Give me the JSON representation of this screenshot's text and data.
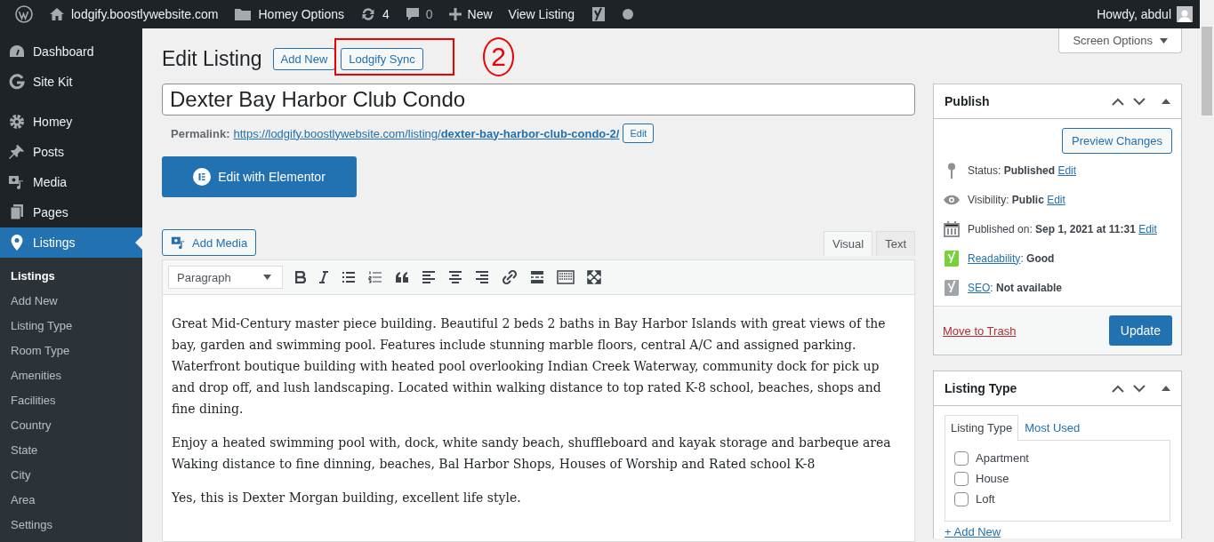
{
  "admin_bar": {
    "site": "lodgify.boostlywebsite.com",
    "items": [
      {
        "kind": "folder",
        "label": "Homey Options"
      },
      {
        "kind": "updates",
        "label": "4"
      },
      {
        "kind": "comments",
        "label": "0"
      },
      {
        "kind": "new",
        "label": "New"
      },
      {
        "kind": "link",
        "label": "View Listing"
      },
      {
        "kind": "yoast"
      },
      {
        "kind": "dot"
      }
    ],
    "account": "Howdy, abdul"
  },
  "sidebar": {
    "items": [
      {
        "label": "Dashboard",
        "selected": false
      },
      {
        "label": "Site Kit",
        "selected": false
      },
      {
        "label": "Homey",
        "selected": false
      },
      {
        "label": "Posts",
        "selected": false
      },
      {
        "label": "Media",
        "selected": false
      },
      {
        "label": "Pages",
        "selected": false
      },
      {
        "label": "Listings",
        "selected": true
      }
    ],
    "submenu": [
      {
        "label": "Listings",
        "selected": true
      },
      {
        "label": "Add New",
        "selected": false
      },
      {
        "label": "Listing Type",
        "selected": false
      },
      {
        "label": "Room Type",
        "selected": false
      },
      {
        "label": "Amenities",
        "selected": false
      },
      {
        "label": "Facilities",
        "selected": false
      },
      {
        "label": "Country",
        "selected": false
      },
      {
        "label": "State",
        "selected": false
      },
      {
        "label": "City",
        "selected": false
      },
      {
        "label": "Area",
        "selected": false
      },
      {
        "label": "Settings",
        "selected": false
      }
    ]
  },
  "screen_options": "Screen Options",
  "header": {
    "title": "Edit Listing",
    "buttons": [
      "Add New",
      "Lodgify Sync"
    ]
  },
  "annotation": {
    "label": "2"
  },
  "title_field": {
    "value": "Dexter Bay Harbor Club Condo"
  },
  "permalink": {
    "label": "Permalink:",
    "base": "https://lodgify.boostlywebsite.com/listing/",
    "slug": "dexter-bay-harbor-club-condo-2/",
    "button": "Edit"
  },
  "elementor_button": "Edit with Elementor",
  "add_media": "Add Media",
  "editor_tabs": [
    {
      "label": "Visual",
      "selected": true
    },
    {
      "label": "Text",
      "selected": false
    }
  ],
  "format_select": "Paragraph",
  "paragraphs": [
    "Great Mid-Century master piece building.  Beautiful 2 beds 2 baths in Bay Harbor Islands with great views of the bay, garden and swimming pool. Features include stunning marble floors, central A/C and assigned parking. Waterfront boutique building with heated pool overlooking Indian Creek Waterway, community dock for pick up and drop off, and lush landscaping. Located within walking distance to top rated K-8 school, beaches, shops and fine dining.",
    "Enjoy a heated swimming pool with, dock, white sandy beach, shuffleboard and kayak storage and barbeque area Waking distance to fine dinning, beaches, Bal Harbor Shops, Houses of Worship and Rated school K-8",
    "Yes, this is Dexter Morgan building, excellent life style."
  ],
  "publish": {
    "title": "Publish",
    "preview": "Preview Changes",
    "rows": [
      {
        "kind": "status",
        "text": "Status: **Published**",
        "link": "Edit"
      },
      {
        "kind": "visibility",
        "text": "Visibility: **Public**",
        "link": "Edit"
      },
      {
        "kind": "date",
        "text": "Published on: **Sep 1, 2021 at 11:31**",
        "link": "Edit"
      },
      {
        "kind": "yoast",
        "color": "#7ad03a",
        "link": "Readability",
        "text": ": **Good**"
      },
      {
        "kind": "yoast",
        "color": "#a0a5aa",
        "link": "SEO",
        "text": ": **Not available**"
      }
    ],
    "trash": "Move to Trash",
    "update": "Update"
  },
  "listing_type": {
    "title": "Listing Type",
    "tabs": [
      {
        "label": "Listing Type",
        "selected": true
      },
      {
        "label": "Most Used",
        "selected": false
      }
    ],
    "options": [
      {
        "label": "Apartment",
        "checked": false
      },
      {
        "label": "House",
        "checked": false
      },
      {
        "label": "Loft",
        "checked": false
      }
    ],
    "add_new": "+ Add New"
  }
}
